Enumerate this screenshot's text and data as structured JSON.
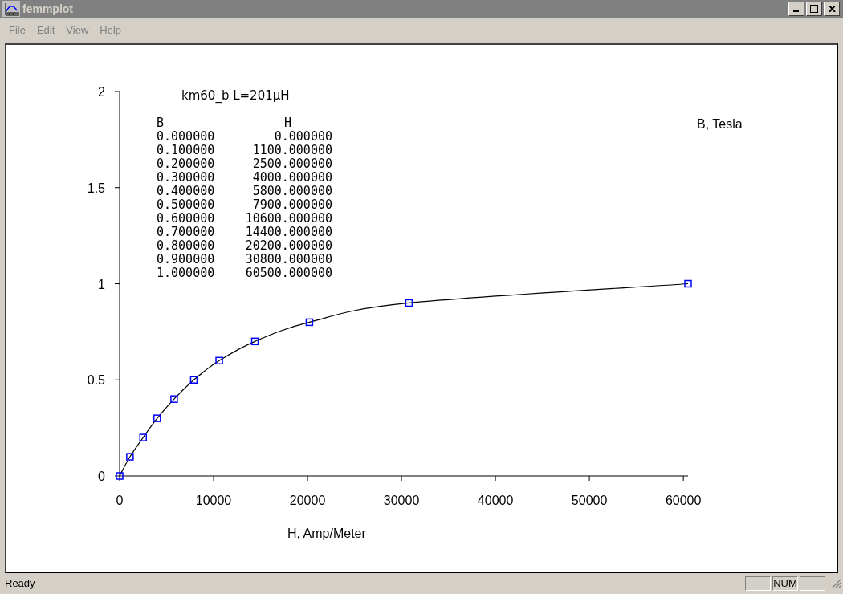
{
  "window": {
    "title": "femmplot"
  },
  "menu": [
    "File",
    "Edit",
    "View",
    "Help"
  ],
  "plot": {
    "chart_data": {
      "type": "line",
      "title": "km60_b L=201μH",
      "xlabel": "H, Amp/Meter",
      "ylabel": "B, Tesla",
      "x": [
        0,
        1100,
        2500,
        4000,
        5800,
        7900,
        10600,
        14400,
        20200,
        30800,
        60500
      ],
      "series": [
        {
          "color": "#0000ff",
          "marker": "square",
          "values": [
            0,
            0.1,
            0.2,
            0.3,
            0.4,
            0.5,
            0.6,
            0.7,
            0.8,
            0.9,
            1.0
          ]
        }
      ],
      "xlim": [
        0,
        60500
      ],
      "ylim": [
        0,
        2
      ],
      "xticks": [
        0,
        10000,
        20000,
        30000,
        40000,
        50000,
        60000
      ],
      "yticks": [
        0,
        0.5,
        1,
        1.5,
        2
      ]
    },
    "table": {
      "columns": [
        "B",
        "H"
      ],
      "rows": [
        [
          "0.000000",
          "0.000000"
        ],
        [
          "0.100000",
          "1100.000000"
        ],
        [
          "0.200000",
          "2500.000000"
        ],
        [
          "0.300000",
          "4000.000000"
        ],
        [
          "0.400000",
          "5800.000000"
        ],
        [
          "0.500000",
          "7900.000000"
        ],
        [
          "0.600000",
          "10600.000000"
        ],
        [
          "0.700000",
          "14400.000000"
        ],
        [
          "0.800000",
          "20200.000000"
        ],
        [
          "0.900000",
          "30800.000000"
        ],
        [
          "1.000000",
          "60500.000000"
        ]
      ]
    }
  },
  "status_bar": {
    "text": "Ready",
    "panes": [
      {
        "kind": "blank"
      },
      {
        "kind": "text",
        "text": "NUM"
      },
      {
        "kind": "blank"
      }
    ]
  }
}
